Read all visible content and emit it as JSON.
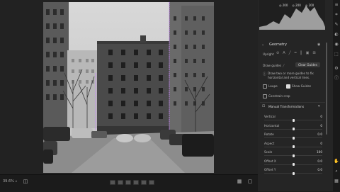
{
  "histogram": {
    "values": [
      "◎ 200",
      "◎ 200",
      "◎ 200"
    ]
  },
  "geometry": {
    "title": "Geometry",
    "upright_label": "Upright",
    "draw_guides_label": "Draw guides",
    "clear_guides_label": "Clear Guides",
    "hint_text_1": "Draw two or more guides to fix",
    "hint_text_2": "horizontal and vertical lines.",
    "loupe_label": "Loupe",
    "show_guides_label": "Show Guides",
    "constrain_label": "Constrain crop",
    "manual_title": "Manual Transformations",
    "sliders": [
      {
        "label": "Vertical",
        "value": "0",
        "position": 0.5
      },
      {
        "label": "Horizontal",
        "value": "0",
        "position": 0.5
      },
      {
        "label": "Rotate",
        "value": "0.0",
        "position": 0.5
      },
      {
        "label": "Aspect",
        "value": "0",
        "position": 0.5
      },
      {
        "label": "Scale",
        "value": "100",
        "position": 0.5
      },
      {
        "label": "Offset X",
        "value": "0.0",
        "position": 0.5
      },
      {
        "label": "Offset Y",
        "value": "0.0",
        "position": 0.5
      }
    ]
  },
  "bottom": {
    "zoom": "39.6%"
  },
  "colors": {
    "accent": "#e5e5e5",
    "guide": "#c77cff"
  }
}
